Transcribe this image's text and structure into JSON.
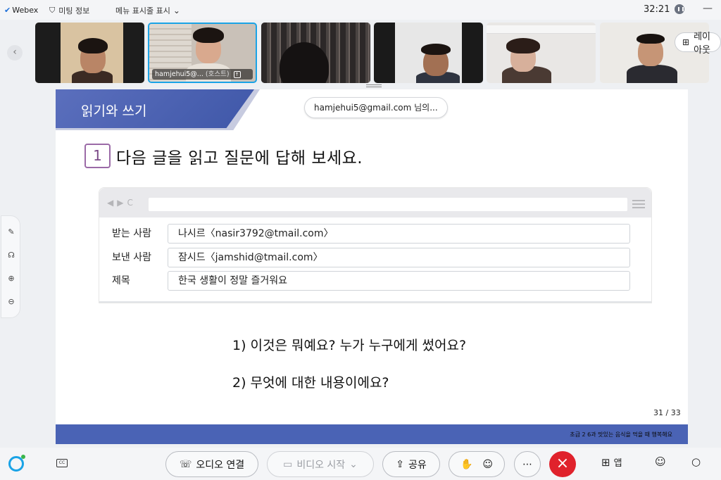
{
  "topbar": {
    "app_name": "Webex",
    "meeting_info": "미팅 정보",
    "menu_toggle": "메뉴 표시줄 표시",
    "timer": "32:21"
  },
  "participants": [
    {
      "name": ""
    },
    {
      "name": "hamjehui5@...",
      "role": "(호스트)"
    },
    {
      "name": ""
    },
    {
      "name": ""
    },
    {
      "name": ""
    },
    {
      "name": ""
    }
  ],
  "layout_button": "레이아웃",
  "share": {
    "presenter_pill": "hamjehui5@gmail.com 님의..."
  },
  "slide": {
    "section_title": "읽기와 쓰기",
    "question_number": "1",
    "question_text": "다음 글을 읽고 질문에 답해 보세요.",
    "email": {
      "fields": [
        {
          "label": "받는 사람",
          "value": "나시르〈nasir3792@tmail.com〉"
        },
        {
          "label": "보낸 사람",
          "value": "잠시드〈jamshid@tmail.com〉"
        },
        {
          "label": "제목",
          "value": "한국 생활이 정말 즐거워요"
        }
      ]
    },
    "questions": [
      "1) 이것은 뭐예요? 누가 누구에게 썼어요?",
      "2) 무엇에 대한 내용이에요?"
    ],
    "page": "31  / 33",
    "footer": "초급 2  6과 맛있는 음식을 먹을 때 행복해요"
  },
  "controls": {
    "audio": "오디오 연결",
    "video": "비디오 시작",
    "share": "공유",
    "apps": "앱"
  },
  "colors": {
    "accent": "#1aa3e6",
    "end_call": "#e0222c",
    "slide_blue": "#4a63b5",
    "number_box": "#9b6aa7"
  }
}
